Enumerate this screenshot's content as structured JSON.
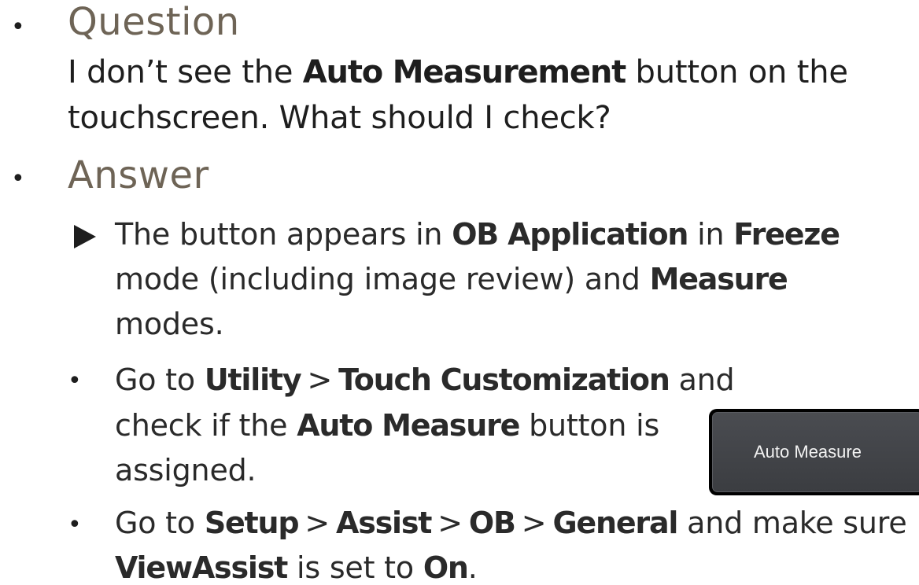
{
  "question": {
    "heading": "Question",
    "line1": {
      "pre": "I don’t see the ",
      "bold": "Auto Measurement",
      "post": " button on the"
    },
    "line2": "touchscreen. What should I check?"
  },
  "answer": {
    "heading": "Answer",
    "item1": {
      "l1_a": "The button appears in ",
      "l1_b": "OB Application",
      "l1_c": " in ",
      "l1_d": "Freeze",
      "l2_a": "mode (including image review) and ",
      "l2_b": "Measure",
      "l3": "modes."
    },
    "item2": {
      "l1_a": "Go to ",
      "l1_b": "Utility",
      "sep": ">",
      "l1_c": "Touch Customization",
      "l1_d": " and",
      "l2_a": "check if the ",
      "l2_b": "Auto Measure",
      "l2_c": " button is",
      "l3": "assigned."
    },
    "item3": {
      "l1_a": "Go to ",
      "l1_b": "Setup",
      "l1_c": "Assist",
      "l1_d": "OB",
      "l1_e": "General",
      "l1_f": " and make sure",
      "l2_a": "ViewAssist",
      "l2_b": " is set to ",
      "l2_c": "On",
      "l2_d": "."
    }
  },
  "button": {
    "label": "Auto Measure"
  },
  "bullet_char": "•"
}
